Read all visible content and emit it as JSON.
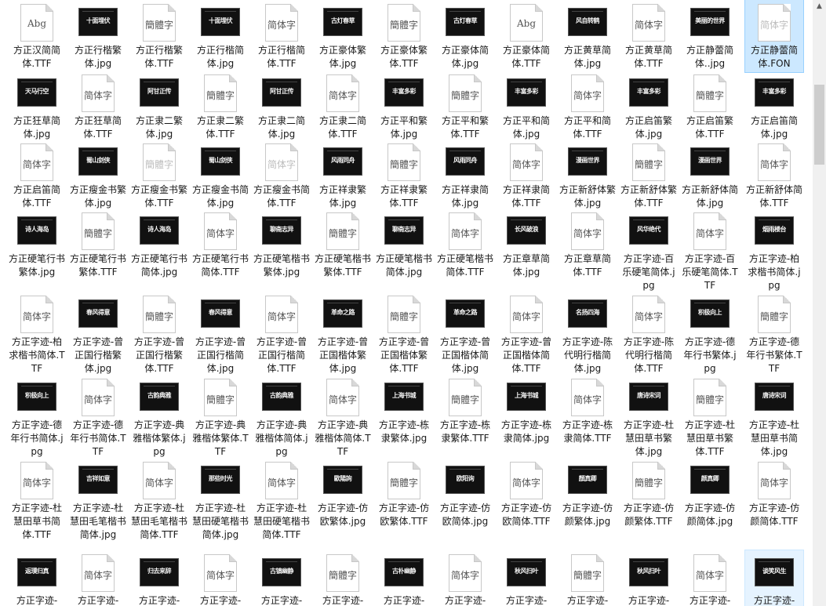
{
  "files": [
    {
      "name": "方正汉简简体.TTF",
      "preview": "Abg",
      "kind": "font"
    },
    {
      "name": "方正行楷繁体.jpg",
      "preview": "十面埋伏",
      "kind": "jpg"
    },
    {
      "name": "方正行楷繁体.TTF",
      "preview": "簡體字",
      "kind": "font"
    },
    {
      "name": "方正行楷简体.jpg",
      "preview": "十面埋伏",
      "kind": "jpg"
    },
    {
      "name": "方正行楷简体.TTF",
      "preview": "简体字",
      "kind": "font"
    },
    {
      "name": "方正豪体繁体.jpg",
      "preview": "古灯春草",
      "kind": "jpg"
    },
    {
      "name": "方正豪体繁体.TTF",
      "preview": "簡體字",
      "kind": "font"
    },
    {
      "name": "方正豪体简体.jpg",
      "preview": "古灯春草",
      "kind": "jpg"
    },
    {
      "name": "方正豪体简体.TTF",
      "preview": "Abg",
      "kind": "font"
    },
    {
      "name": "方正黄草简体.jpg",
      "preview": "风自转鹤",
      "kind": "jpg"
    },
    {
      "name": "方正黄草简体.TTF",
      "preview": "简体字",
      "kind": "font"
    },
    {
      "name": "方正静蕾简体..jpg",
      "preview": "美丽的世界",
      "kind": "jpg"
    },
    {
      "name": "方正静蕾简体.FON",
      "preview": "简体字",
      "kind": "font",
      "state": "selected",
      "faint": true
    },
    {
      "name": "方正狂草简体.jpg",
      "preview": "天马行空",
      "kind": "jpg"
    },
    {
      "name": "方正狂草简体.TTF",
      "preview": "简体字",
      "kind": "font"
    },
    {
      "name": "方正隶二繁体.jpg",
      "preview": "阿甘正传",
      "kind": "jpg"
    },
    {
      "name": "方正隶二繁体.TTF",
      "preview": "簡體字",
      "kind": "font"
    },
    {
      "name": "方正隶二简体.jpg",
      "preview": "阿甘正传",
      "kind": "jpg"
    },
    {
      "name": "方正隶二简体.TTF",
      "preview": "简体字",
      "kind": "font"
    },
    {
      "name": "方正平和繁体.jpg",
      "preview": "丰富多彩",
      "kind": "jpg"
    },
    {
      "name": "方正平和繁体.TTF",
      "preview": "簡體字",
      "kind": "font"
    },
    {
      "name": "方正平和简体.jpg",
      "preview": "丰富多彩",
      "kind": "jpg"
    },
    {
      "name": "方正平和简体.TTF",
      "preview": "简体字",
      "kind": "font"
    },
    {
      "name": "方正启笛繁体.jpg",
      "preview": "丰富多彩",
      "kind": "jpg"
    },
    {
      "name": "方正启笛繁体.TTF",
      "preview": "簡體字",
      "kind": "font"
    },
    {
      "name": "方正启笛简体.jpg",
      "preview": "丰富多彩",
      "kind": "jpg"
    },
    {
      "name": "方正启笛简体.TTF",
      "preview": "简体字",
      "kind": "font"
    },
    {
      "name": "方正瘦金书繁体.jpg",
      "preview": "蜀山剑侠",
      "kind": "jpg"
    },
    {
      "name": "方正瘦金书繁体.TTF",
      "preview": "簡體字",
      "kind": "font",
      "faint": true
    },
    {
      "name": "方正瘦金书简体.jpg",
      "preview": "蜀山剑侠",
      "kind": "jpg"
    },
    {
      "name": "方正瘦金书简体.TTF",
      "preview": "简体字",
      "kind": "font",
      "faint": true
    },
    {
      "name": "方正祥隶繁体.jpg",
      "preview": "风雨同舟",
      "kind": "jpg"
    },
    {
      "name": "方正祥隶繁体.TTF",
      "preview": "簡體字",
      "kind": "font"
    },
    {
      "name": "方正祥隶简体.jpg",
      "preview": "风雨同舟",
      "kind": "jpg"
    },
    {
      "name": "方正祥隶简体.TTF",
      "preview": "简体字",
      "kind": "font"
    },
    {
      "name": "方正新舒体繁体.jpg",
      "preview": "漫画世界",
      "kind": "jpg"
    },
    {
      "name": "方正新舒体繁体.TTF",
      "preview": "簡體字",
      "kind": "font"
    },
    {
      "name": "方正新舒体简体.jpg",
      "preview": "漫画世界",
      "kind": "jpg"
    },
    {
      "name": "方正新舒体简体.TTF",
      "preview": "简体字",
      "kind": "font"
    },
    {
      "name": "方正硬笔行书繁体.jpg",
      "preview": "诗人海岛",
      "kind": "jpg"
    },
    {
      "name": "方正硬笔行书繁体.TTF",
      "preview": "簡體字",
      "kind": "font"
    },
    {
      "name": "方正硬笔行书简体.jpg",
      "preview": "诗人海岛",
      "kind": "jpg"
    },
    {
      "name": "方正硬笔行书简体.TTF",
      "preview": "简体字",
      "kind": "font"
    },
    {
      "name": "方正硬笔楷书繁体.jpg",
      "preview": "聊斋志异",
      "kind": "jpg"
    },
    {
      "name": "方正硬笔楷书繁体.TTF",
      "preview": "簡體字",
      "kind": "font"
    },
    {
      "name": "方正硬笔楷书简体.jpg",
      "preview": "聊斋志异",
      "kind": "jpg"
    },
    {
      "name": "方正硬笔楷书简体.TTF",
      "preview": "简体字",
      "kind": "font"
    },
    {
      "name": "方正章草简体.jpg",
      "preview": "长风破浪",
      "kind": "jpg"
    },
    {
      "name": "方正章草简体.TTF",
      "preview": "简体字",
      "kind": "font"
    },
    {
      "name": "方正字迹-百乐硬笔简体.jpg",
      "preview": "风华绝代",
      "kind": "jpg"
    },
    {
      "name": "方正字迹-百乐硬笔简体.TTF",
      "preview": "简体字",
      "kind": "font"
    },
    {
      "name": "方正字迹-柏求楷书简体.jpg",
      "preview": "烟雨楼台",
      "kind": "jpg"
    },
    {
      "name": "方正字迹-柏求楷书简体.TTF",
      "preview": "简体字",
      "kind": "font"
    },
    {
      "name": "方正字迹-曾正国行楷繁体.jpg",
      "preview": "春风得意",
      "kind": "jpg"
    },
    {
      "name": "方正字迹-曾正国行楷繁体.TTF",
      "preview": "簡體字",
      "kind": "font"
    },
    {
      "name": "方正字迹-曾正国行楷简体.jpg",
      "preview": "春风得意",
      "kind": "jpg"
    },
    {
      "name": "方正字迹-曾正国行楷简体.TTF",
      "preview": "简体字",
      "kind": "font"
    },
    {
      "name": "方正字迹-曾正国楷体繁体.jpg",
      "preview": "革命之路",
      "kind": "jpg"
    },
    {
      "name": "方正字迹-曾正国楷体繁体.TTF",
      "preview": "簡體字",
      "kind": "font"
    },
    {
      "name": "方正字迹-曾正国楷体简体.jpg",
      "preview": "革命之路",
      "kind": "jpg"
    },
    {
      "name": "方正字迹-曾正国楷体简体.TTF",
      "preview": "简体字",
      "kind": "font"
    },
    {
      "name": "方正字迹-陈代明行楷简体.jpg",
      "preview": "名扬四海",
      "kind": "jpg"
    },
    {
      "name": "方正字迹-陈代明行楷简体.TTF",
      "preview": "简体字",
      "kind": "font"
    },
    {
      "name": "方正字迹-德年行书繁体.jpg",
      "preview": "积极向上",
      "kind": "jpg"
    },
    {
      "name": "方正字迹-德年行书繁体.TTF",
      "preview": "簡體字",
      "kind": "font"
    },
    {
      "name": "方正字迹-德年行书简体.jpg",
      "preview": "积极向上",
      "kind": "jpg"
    },
    {
      "name": "方正字迹-德年行书简体.TTF",
      "preview": "简体字",
      "kind": "font"
    },
    {
      "name": "方正字迹-典雅楷体繁体.jpg",
      "preview": "古韵典雅",
      "kind": "jpg"
    },
    {
      "name": "方正字迹-典雅楷体繁体.TTF",
      "preview": "簡體字",
      "kind": "font"
    },
    {
      "name": "方正字迹-典雅楷体简体.jpg",
      "preview": "古韵典雅",
      "kind": "jpg"
    },
    {
      "name": "方正字迹-典雅楷体简体.TTF",
      "preview": "简体字",
      "kind": "font"
    },
    {
      "name": "方正字迹-栋隶繁体.jpg",
      "preview": "上海书城",
      "kind": "jpg"
    },
    {
      "name": "方正字迹-栋隶繁体.TTF",
      "preview": "簡體字",
      "kind": "font"
    },
    {
      "name": "方正字迹-栋隶简体.jpg",
      "preview": "上海书城",
      "kind": "jpg"
    },
    {
      "name": "方正字迹-栋隶简体.TTF",
      "preview": "简体字",
      "kind": "font"
    },
    {
      "name": "方正字迹-杜慧田草书繁体.jpg",
      "preview": "唐诗宋词",
      "kind": "jpg"
    },
    {
      "name": "方正字迹-杜慧田草书繁体.TTF",
      "preview": "簡體字",
      "kind": "font"
    },
    {
      "name": "方正字迹-杜慧田草书简体.jpg",
      "preview": "唐诗宋词",
      "kind": "jpg"
    },
    {
      "name": "方正字迹-杜慧田草书简体.TTF",
      "preview": "简体字",
      "kind": "font"
    },
    {
      "name": "方正字迹-杜慧田毛笔楷书简体.jpg",
      "preview": "吉祥如意",
      "kind": "jpg"
    },
    {
      "name": "方正字迹-杜慧田毛笔楷书简体.TTF",
      "preview": "简体字",
      "kind": "font"
    },
    {
      "name": "方正字迹-杜慧田硬笔楷书简体.jpg",
      "preview": "那些时光",
      "kind": "jpg"
    },
    {
      "name": "方正字迹-杜慧田硬笔楷书简体.TTF",
      "preview": "简体字",
      "kind": "font"
    },
    {
      "name": "方正字迹-仿欧繁体.jpg",
      "preview": "歐陽詢",
      "kind": "jpg"
    },
    {
      "name": "方正字迹-仿欧繁体.TTF",
      "preview": "簡體字",
      "kind": "font"
    },
    {
      "name": "方正字迹-仿欧简体.jpg",
      "preview": "欧阳询",
      "kind": "jpg"
    },
    {
      "name": "方正字迹-仿欧简体.TTF",
      "preview": "简体字",
      "kind": "font"
    },
    {
      "name": "方正字迹-仿颜繁体.jpg",
      "preview": "顏真卿",
      "kind": "jpg"
    },
    {
      "name": "方正字迹-仿颜繁体.TTF",
      "preview": "簡體字",
      "kind": "font"
    },
    {
      "name": "方正字迹-仿颜简体.jpg",
      "preview": "颜真卿",
      "kind": "jpg"
    },
    {
      "name": "方正字迹-仿颜简体.TTF",
      "preview": "简体字",
      "kind": "font"
    },
    {
      "name": "方正字迹-",
      "preview": "返璞归真",
      "kind": "jpg"
    },
    {
      "name": "方正字迹-",
      "preview": "简体字",
      "kind": "font"
    },
    {
      "name": "方正字迹-",
      "preview": "归去来辞",
      "kind": "jpg"
    },
    {
      "name": "方正字迹-",
      "preview": "简体字",
      "kind": "font"
    },
    {
      "name": "方正字迹-",
      "preview": "古镇幽静",
      "kind": "jpg"
    },
    {
      "name": "方正字迹-",
      "preview": "簡體字",
      "kind": "font"
    },
    {
      "name": "方正字迹-",
      "preview": "古朴幽静",
      "kind": "jpg"
    },
    {
      "name": "方正字迹-",
      "preview": "简体字",
      "kind": "font"
    },
    {
      "name": "方正字迹-",
      "preview": "秋风扫叶",
      "kind": "jpg"
    },
    {
      "name": "方正字迹-",
      "preview": "簡體字",
      "kind": "font"
    },
    {
      "name": "方正字迹-",
      "preview": "秋风扫叶",
      "kind": "jpg"
    },
    {
      "name": "方正字迹-",
      "preview": "简体字",
      "kind": "font"
    },
    {
      "name": "方正字迹-",
      "preview": "谈笑风生",
      "kind": "jpg",
      "state": "hover"
    }
  ],
  "colors": {
    "selected_bg": "#cce8ff",
    "hover_bg": "#e5f3ff",
    "label_text": "#1a1a1a"
  },
  "scrollbar": {
    "up_icon": "▲",
    "scroll_fraction": 0.15
  }
}
